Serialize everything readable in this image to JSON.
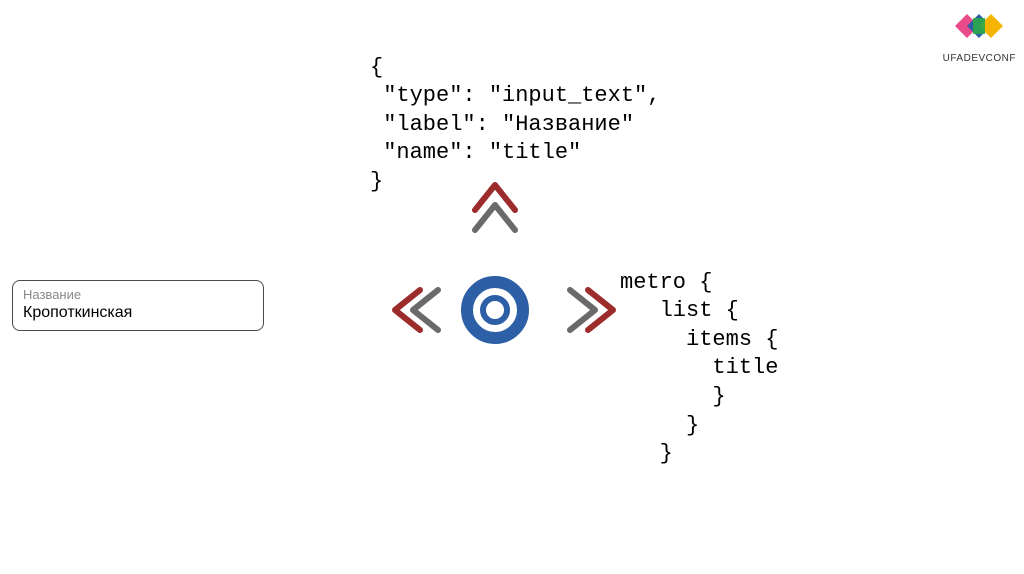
{
  "json_snippet": {
    "open": "{",
    "line1": " \"type\": \"input_text\",",
    "line2": " \"label\": \"Название\"",
    "line3": " \"name\": \"title\"",
    "close": "}"
  },
  "graphql_snippet": {
    "line1": "metro {",
    "line2": "   list {",
    "line3": "     items {",
    "line4": "       title",
    "line5": "       }",
    "line6": "     }",
    "line7": "   }"
  },
  "form": {
    "label": "Название",
    "value": "Кропоткинская"
  },
  "logo": {
    "caption": "UFADEVCONF"
  },
  "colors": {
    "arrow_red": "#9c2b2b",
    "arrow_gray": "#6a6a6a",
    "ring_blue": "#2c5fa5"
  }
}
